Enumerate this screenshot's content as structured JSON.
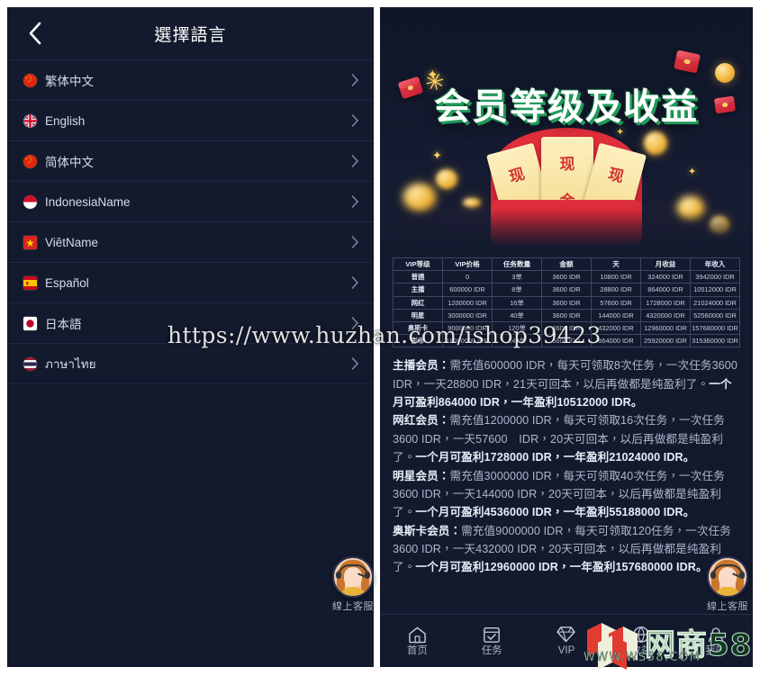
{
  "left_panel": {
    "header": {
      "back_icon": "chevron-left-icon",
      "title": "選擇語言"
    },
    "languages": [
      {
        "name": "繁体中文",
        "flag": "cn",
        "chevron": "chevron-right-icon"
      },
      {
        "name": "English",
        "flag": "gb",
        "chevron": "chevron-right-icon"
      },
      {
        "name": "简体中文",
        "flag": "cn",
        "chevron": "chevron-right-icon"
      },
      {
        "name": "IndonesiaName",
        "flag": "id",
        "chevron": "chevron-right-icon"
      },
      {
        "name": "ViêtName",
        "flag": "vn",
        "chevron": "chevron-right-icon"
      },
      {
        "name": "Español",
        "flag": "es",
        "chevron": "chevron-right-icon"
      },
      {
        "name": "日本語",
        "flag": "jp",
        "chevron": "chevron-right-icon"
      },
      {
        "name": "ภาษาไทย",
        "flag": "th",
        "chevron": "chevron-right-icon"
      }
    ],
    "customer_service": {
      "label": "線上客服",
      "icon": "headset-avatar-icon"
    }
  },
  "right_panel": {
    "banner": {
      "title": "会员等级及收益",
      "ticket_text": "现",
      "ticket_text_2": "金"
    },
    "table": {
      "headers": [
        "VIP等级",
        "VIP价格",
        "任务数量",
        "金额",
        "天",
        "月收益",
        "年收入"
      ],
      "rows": [
        [
          "普通",
          "0",
          "3单",
          "3600 IDR",
          "10800 IDR",
          "324000 IDR",
          "3942000 IDR"
        ],
        [
          "主播",
          "600000 IDR",
          "8单",
          "3600 IDR",
          "28800 IDR",
          "864000 IDR",
          "10512000 IDR"
        ],
        [
          "网红",
          "1200000 IDR",
          "16单",
          "3600 IDR",
          "57600 IDR",
          "1728000 IDR",
          "21024000 IDR"
        ],
        [
          "明星",
          "3000000 IDR",
          "40单",
          "3600 IDR",
          "144000 IDR",
          "4320000 IDR",
          "52560000 IDR"
        ],
        [
          "奥斯卡",
          "9000000 IDR",
          "120单",
          "3600 IDR",
          "432000 IDR",
          "12960000 IDR",
          "157680000 IDR"
        ],
        [
          "影帝",
          "18000000 IDR",
          "240单",
          "3600 IDR",
          "864000 IDR",
          "25920000 IDR",
          "315360000 IDR"
        ]
      ]
    },
    "descriptions": [
      {
        "label": "主播会员：",
        "body": "需充值600000 IDR，每天可领取8次任务，一次任务3600 IDR，一天28800 IDR，21天可回本，以后再做都是纯盈利了。",
        "highlight": "一个月可盈利864000 IDR，一年盈利10512000 IDR。"
      },
      {
        "label": "网红会员：",
        "body": "需充值1200000 IDR，每天可领取16次任务，一次任务3600 IDR，一天57600　IDR，20天可回本，以后再做都是纯盈利了。",
        "highlight": "一个月可盈利1728000 IDR，一年盈利21024000 IDR。"
      },
      {
        "label": "明星会员：",
        "body": "需充值3000000 IDR，每天可领取40次任务，一次任务3600 IDR，一天144000 IDR，20天可回本，以后再做都是纯盈利了。",
        "highlight": "一个月可盈利4536000 IDR，一年盈利55188000 IDR。"
      },
      {
        "label": "奥斯卡会员：",
        "body": "需充值9000000 IDR，每天可领取120任务，一次任务3600 IDR，一天432000 IDR，20天可回本，以后再做都是纯盈利了。",
        "highlight": "一个月可盈利12960000 IDR，一年盈利157680000 IDR。"
      }
    ],
    "tabbar": [
      {
        "label": "首页",
        "icon": "home-icon",
        "active": false
      },
      {
        "label": "任务",
        "icon": "calendar-check-icon",
        "active": false
      },
      {
        "label": "VIP",
        "icon": "diamond-icon",
        "active": false
      },
      {
        "label": "收益",
        "icon": "globe-icon",
        "active": false
      },
      {
        "label": "我的",
        "icon": "user-icon",
        "active": false
      }
    ],
    "customer_service": {
      "label": "線上客服",
      "icon": "headset-avatar-icon"
    }
  },
  "watermark": {
    "url": "https://www.huzhan.com/ishop39423",
    "brand": "网商58",
    "site": "WWW.WS58.COM",
    "logo_icon": "cube-logo-icon"
  },
  "colors": {
    "panel_bg": "#131a2e",
    "divider": "#1e2741",
    "text_primary": "#d7dced",
    "text_muted": "#aeb7cb",
    "table_border": "#3c4763",
    "accent_red": "#e7313e",
    "accent_gold": "#f0b73f",
    "title_green": "#1f9a58"
  }
}
